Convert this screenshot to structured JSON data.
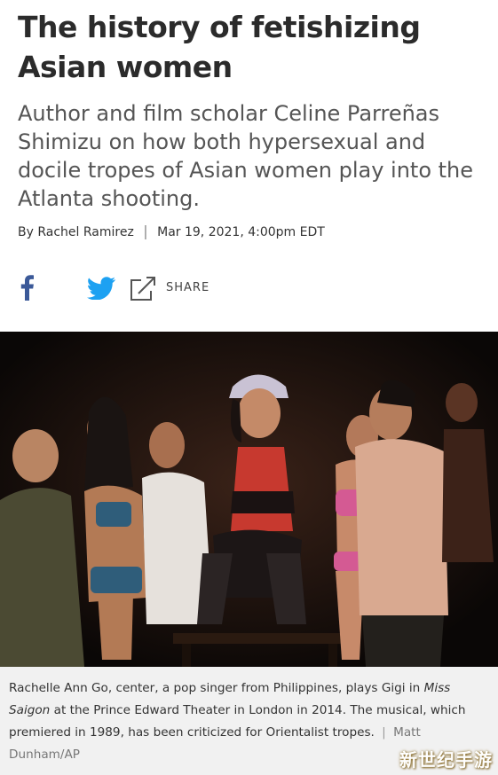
{
  "article": {
    "headline": "The history of fetishizing Asian women",
    "dek": "Author and film scholar Celine Parreñas Shimizu on how both hypersexual and docile tropes of Asian women play into the Atlanta shooting.",
    "byline_prefix": "By",
    "author": "Rachel Ramirez",
    "byline_separator": "|",
    "timestamp": "Mar 19, 2021, 4:00pm EDT"
  },
  "share": {
    "facebook_icon": "facebook-icon",
    "twitter_icon": "twitter-icon",
    "share_icon": "share-icon",
    "share_label": "SHARE"
  },
  "photo": {
    "description_icon": "stage-photo"
  },
  "caption": {
    "text_before_italic": "Rachelle Ann Go, center, a pop singer from Philippines, plays Gigi in ",
    "italic_title": "Miss Saigon",
    "text_after_italic": " at the Prince Edward Theater in London in 2014. The musical, which premiered in 1989, has been criticized for Orientalist tropes.",
    "separator": "|",
    "credit": "Matt Dunham/AP"
  },
  "watermark": {
    "text": "新世纪手游"
  },
  "colors": {
    "facebook": "#3b5998",
    "twitter": "#1da1f2",
    "caption_bg": "#f1f1f1"
  }
}
